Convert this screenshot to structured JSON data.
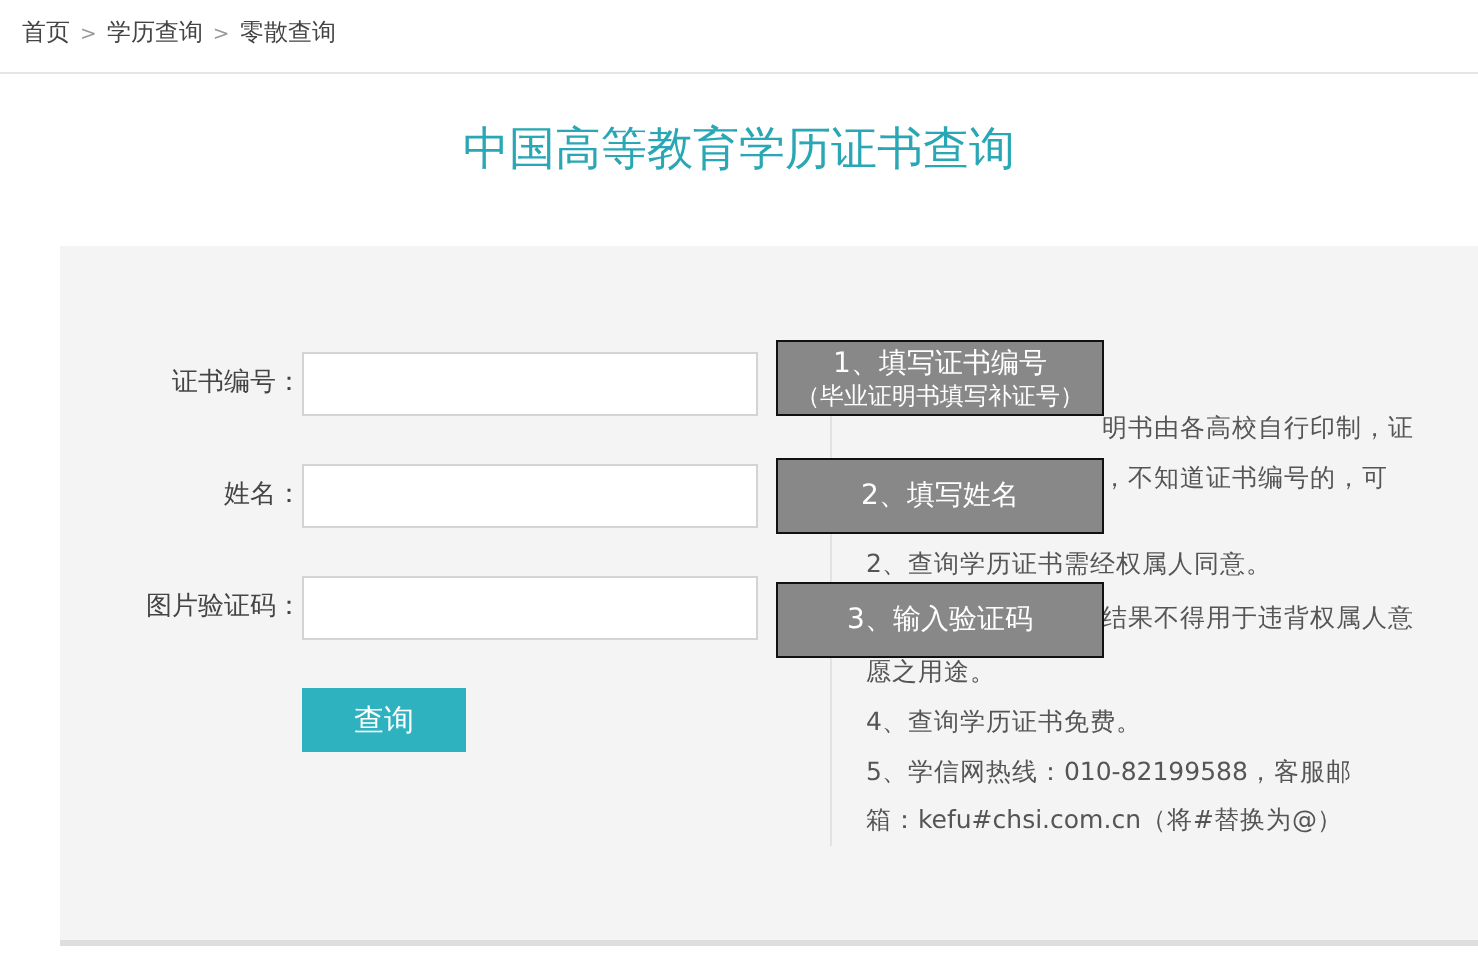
{
  "breadcrumb": [
    {
      "label": "首页"
    },
    {
      "label": "学历查询"
    },
    {
      "label": "零散查询"
    }
  ],
  "breadcrumb_separator": ">",
  "title": "中国高等教育学历证书查询",
  "form": {
    "fields": [
      {
        "label": "证书编号："
      },
      {
        "label": "姓名："
      },
      {
        "label": "图片验证码："
      }
    ],
    "submit": "查询"
  },
  "notes": [
    {
      "kind": "partial",
      "text": "明书由各高校自行印制，证"
    },
    {
      "kind": "partial",
      "text": "，不知道证书编号的，可"
    },
    {
      "kind": "full",
      "text": "2、查询学历证书需经权属人同意。"
    },
    {
      "kind": "partial",
      "text": "结果不得用于违背权属人意"
    },
    {
      "kind": "full",
      "text": "愿之用途。"
    },
    {
      "kind": "full",
      "text": "4、查询学历证书免费。"
    },
    {
      "kind": "full",
      "text": "5、学信网热线：010-82199588，客服邮"
    },
    {
      "kind": "full",
      "text": "箱：kefu#chsi.com.cn（将#替换为@）"
    }
  ],
  "hints": [
    {
      "lines": [
        "1、填写证书编号",
        "（毕业证明书填写补证号）"
      ]
    },
    {
      "lines": [
        "2、填写姓名"
      ]
    },
    {
      "lines": [
        "3、输入验证码"
      ]
    }
  ]
}
